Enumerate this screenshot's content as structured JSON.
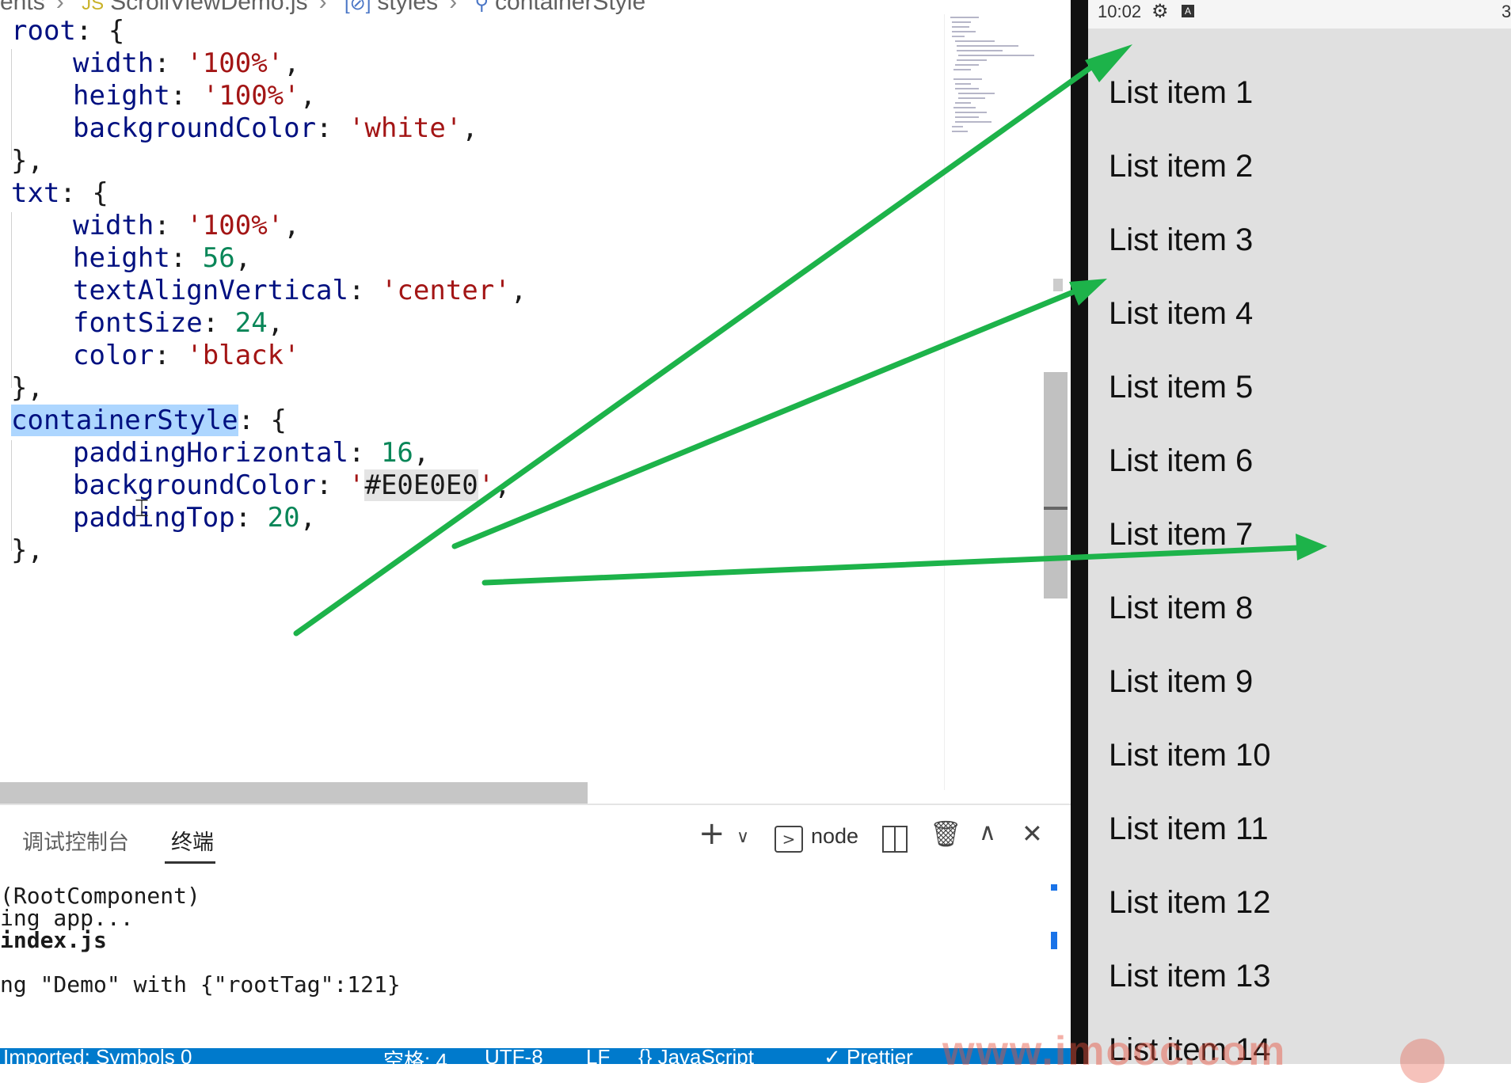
{
  "editor": {
    "breadcrumb": {
      "folder": "ents",
      "file": "ScrollViewDemo.js",
      "symbol": "styles",
      "property": "containerStyle"
    },
    "code": {
      "root_key": "root",
      "root_width_key": "width",
      "root_width_val": "'100%'",
      "root_height_key": "height",
      "root_height_val": "'100%'",
      "root_bg_key": "backgroundColor",
      "root_bg_val": "'white'",
      "txt_key": "txt",
      "txt_width_key": "width",
      "txt_width_val": "'100%'",
      "txt_height_key": "height",
      "txt_height_val": "56",
      "txt_align_key": "textAlignVertical",
      "txt_align_val": "'center'",
      "txt_font_key": "fontSize",
      "txt_font_val": "24",
      "txt_color_key": "color",
      "txt_color_val": "'black'",
      "container_key": "containerStyle",
      "container_pad_key": "paddingHorizontal",
      "container_pad_val": "16",
      "container_bg_key": "backgroundColor",
      "container_bg_val_open": "'",
      "container_bg_val": "#E0E0E0",
      "container_bg_val_close": "'",
      "container_padtop_key": "paddingTop",
      "container_padtop_val": "20"
    }
  },
  "panel": {
    "tabs": [
      "调试控制台",
      "终端"
    ],
    "active_tab": "终端",
    "shell_label": "node",
    "terminal_lines": [
      "(RootComponent)",
      "ing app...",
      "index.js",
      "",
      "ng \"Demo\" with {\"rootTag\":121}"
    ]
  },
  "statusbar": {
    "items": [
      "Imported: Symbols 0",
      "空格: 4",
      "UTF-8",
      "LF",
      "{} JavaScript",
      "✓ Prettier"
    ]
  },
  "phone": {
    "time": "10:02",
    "battery": "3",
    "background_color": "#E0E0E0",
    "list_items": [
      "List item 1",
      "List item 2",
      "List item 3",
      "List item 4",
      "List item 5",
      "List item 6",
      "List item 7",
      "List item 8",
      "List item 9",
      "List item 10",
      "List item 11",
      "List item 12",
      "List item 13",
      "List item 14"
    ]
  },
  "watermark": "www.imooc.com",
  "colors": {
    "arrow": "#1db34a",
    "selection": "#add6ff",
    "statusbar": "#007acc"
  }
}
